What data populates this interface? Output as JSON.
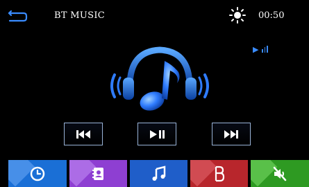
{
  "header": {
    "title": "BT MUSIC",
    "clock": "00:50",
    "icons": [
      "back-arrow-icon",
      "brightness-sun-icon"
    ]
  },
  "status": {
    "icons": [
      "play-indicator-icon",
      "signal-bars-icon"
    ]
  },
  "hero": {
    "icon": "headphones-music-note-icon"
  },
  "controls": [
    {
      "name": "previous-track-button",
      "icon": "skip-previous-icon"
    },
    {
      "name": "play-pause-button",
      "icon": "play-pause-icon"
    },
    {
      "name": "next-track-button",
      "icon": "skip-next-icon"
    }
  ],
  "dock": [
    {
      "name": "dock-clock",
      "icon": "clock-icon",
      "color": "#1a6fd6"
    },
    {
      "name": "dock-contacts",
      "icon": "contacts-book-icon",
      "color": "#8e3fd2"
    },
    {
      "name": "dock-music",
      "icon": "music-note-icon",
      "color": "#1f5ec9"
    },
    {
      "name": "dock-bluetooth",
      "icon": "bluetooth-icon",
      "color": "#b8262c"
    },
    {
      "name": "dock-mute",
      "icon": "mute-speaker-icon",
      "color": "#2e9a22"
    }
  ],
  "colors": {
    "accent": "#2f7cff",
    "background": "#000000"
  }
}
